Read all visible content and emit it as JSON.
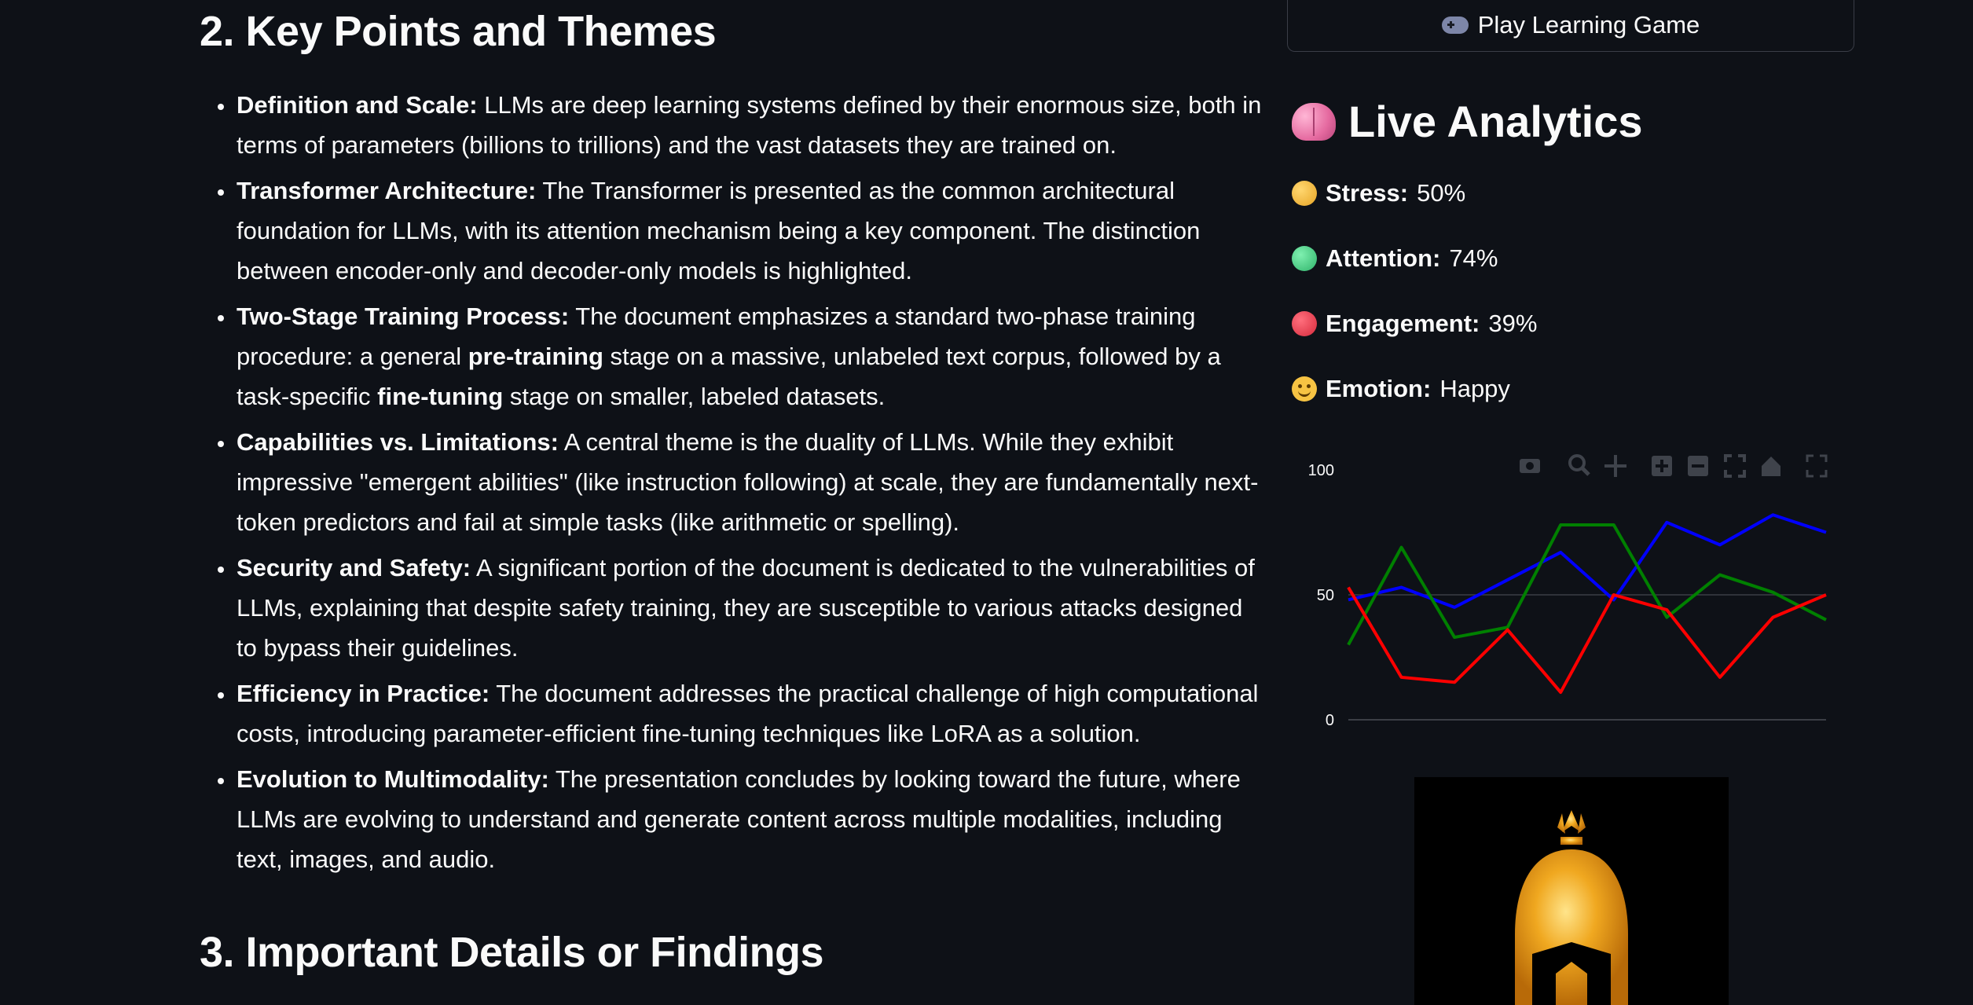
{
  "section2": {
    "heading": "2. Key Points and Themes",
    "points": [
      {
        "title": "Definition and Scale:",
        "text": " LLMs are deep learning systems defined by their enormous size, both in terms of parameters (billions to trillions) and the vast datasets they are trained on."
      },
      {
        "title": "Transformer Architecture:",
        "text": " The Transformer is presented as the common architectural foundation for LLMs, with its attention mechanism being a key component. The distinction between encoder-only and decoder-only models is highlighted."
      },
      {
        "title": "Two-Stage Training Process:",
        "text_a": " The document emphasizes a standard two-phase training procedure: a general ",
        "bold_a": "pre-training",
        "text_b": " stage on a massive, unlabeled text corpus, followed by a task-specific ",
        "bold_b": "fine-tuning",
        "text_c": " stage on smaller, labeled datasets."
      },
      {
        "title": "Capabilities vs. Limitations:",
        "text": " A central theme is the duality of LLMs. While they exhibit impressive \"emergent abilities\" (like instruction following) at scale, they are fundamentally next-token predictors and fail at simple tasks (like arithmetic or spelling)."
      },
      {
        "title": "Security and Safety:",
        "text": " A significant portion of the document is dedicated to the vulnerabilities of LLMs, explaining that despite safety training, they are susceptible to various attacks designed to bypass their guidelines."
      },
      {
        "title": "Efficiency in Practice:",
        "text": " The document addresses the practical challenge of high computational costs, introducing parameter-efficient fine-tuning techniques like LoRA as a solution."
      },
      {
        "title": "Evolution to Multimodality:",
        "text": " The presentation concludes by looking toward the future, where LLMs are evolving to understand and generate content across multiple modalities, including text, images, and audio."
      }
    ]
  },
  "section3": {
    "heading": "3. Important Details or Findings"
  },
  "sidebar": {
    "game_button": {
      "label": "Play Learning Game",
      "icon": "gamepad-icon"
    },
    "analytics": {
      "title": "Live Analytics",
      "icon": "brain-icon",
      "metrics": [
        {
          "label": "Stress:",
          "value": "50%",
          "icon": "yellow-circle-icon",
          "color": "#f2b532"
        },
        {
          "label": "Attention:",
          "value": "74%",
          "icon": "green-circle-icon",
          "color": "#3ccf7e"
        },
        {
          "label": "Engagement:",
          "value": "39%",
          "icon": "red-circle-icon",
          "color": "#e8384c"
        },
        {
          "label": "Emotion:",
          "value": "Happy",
          "icon": "smiling-face-icon",
          "color": "#f6c343"
        }
      ]
    }
  },
  "chart_data": {
    "type": "line",
    "x": [
      0,
      1,
      2,
      3,
      4,
      5,
      6,
      7,
      8,
      9
    ],
    "ylim": [
      0,
      100
    ],
    "yticks": [
      0,
      50,
      100
    ],
    "grid": true,
    "legend": "none",
    "series": [
      {
        "color": "#0000ff",
        "values": [
          48,
          53,
          45,
          56,
          67,
          48,
          79,
          70,
          82,
          75
        ]
      },
      {
        "color": "#008000",
        "values": [
          30,
          69,
          33,
          37,
          78,
          78,
          41,
          58,
          51,
          40
        ]
      },
      {
        "color": "#ff0000",
        "values": [
          53,
          17,
          15,
          36,
          11,
          50,
          44,
          17,
          41,
          50
        ]
      }
    ],
    "modebar_icons": [
      "camera-icon",
      "zoom-icon",
      "pan-icon",
      "zoom-in-icon",
      "zoom-out-icon",
      "autoscale-icon",
      "home-icon",
      "fullscreen-icon"
    ]
  },
  "logo": {
    "icon": "spartan-helmet-logo"
  }
}
